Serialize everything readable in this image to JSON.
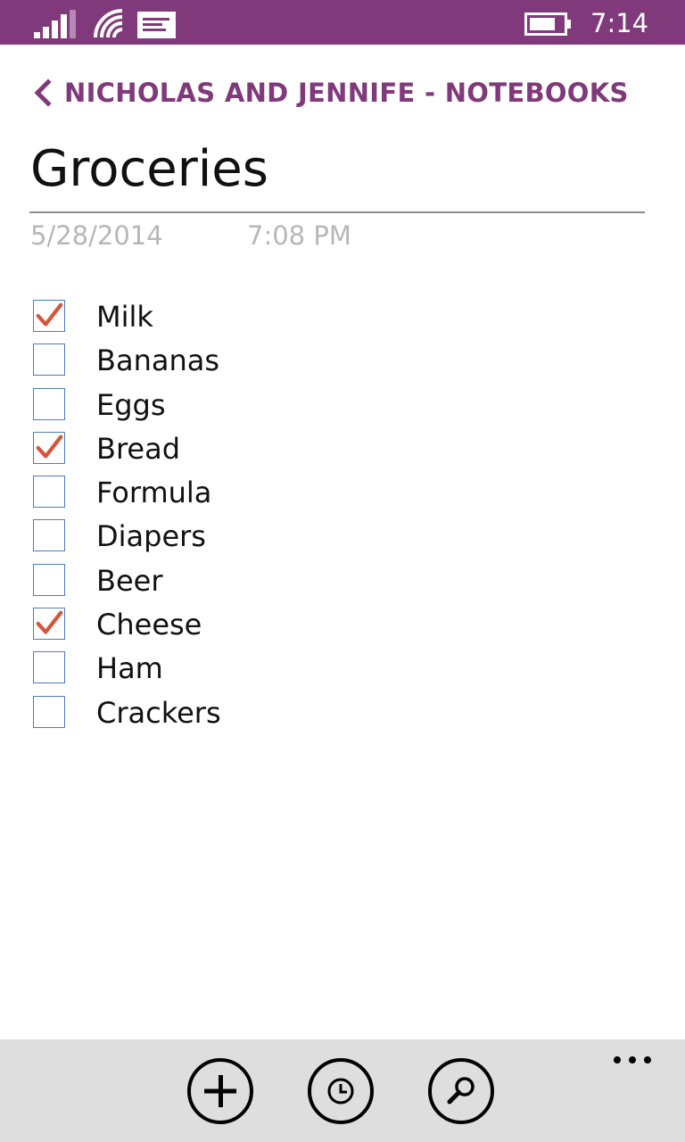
{
  "status_bar": {
    "time": "7:14",
    "background": "#80397b",
    "icons": [
      "signal-strength-icon",
      "wifi-icon",
      "message-icon",
      "battery-icon"
    ]
  },
  "header": {
    "breadcrumb": "NICHOLAS AND JENNIFE - NOTEBOOKS",
    "back_icon": "chevron-left-icon",
    "accent": "#80397b"
  },
  "page": {
    "title": "Groceries",
    "date": "5/28/2014",
    "time": "7:08 PM"
  },
  "checklist": [
    {
      "label": "Milk",
      "checked": true
    },
    {
      "label": "Bananas",
      "checked": false
    },
    {
      "label": "Eggs",
      "checked": false
    },
    {
      "label": "Bread",
      "checked": true
    },
    {
      "label": "Formula",
      "checked": false
    },
    {
      "label": "Diapers",
      "checked": false
    },
    {
      "label": "Beer",
      "checked": false
    },
    {
      "label": "Cheese",
      "checked": true
    },
    {
      "label": "Ham",
      "checked": false
    },
    {
      "label": "Crackers",
      "checked": false
    }
  ],
  "colors": {
    "checkbox_border": "#4f7bbd",
    "checkmark": "#d5553b",
    "app_bar": "#dedede"
  },
  "app_bar": {
    "buttons": [
      "add-icon",
      "recent-clock-icon",
      "search-icon"
    ],
    "more_icon": "ellipsis-icon"
  }
}
